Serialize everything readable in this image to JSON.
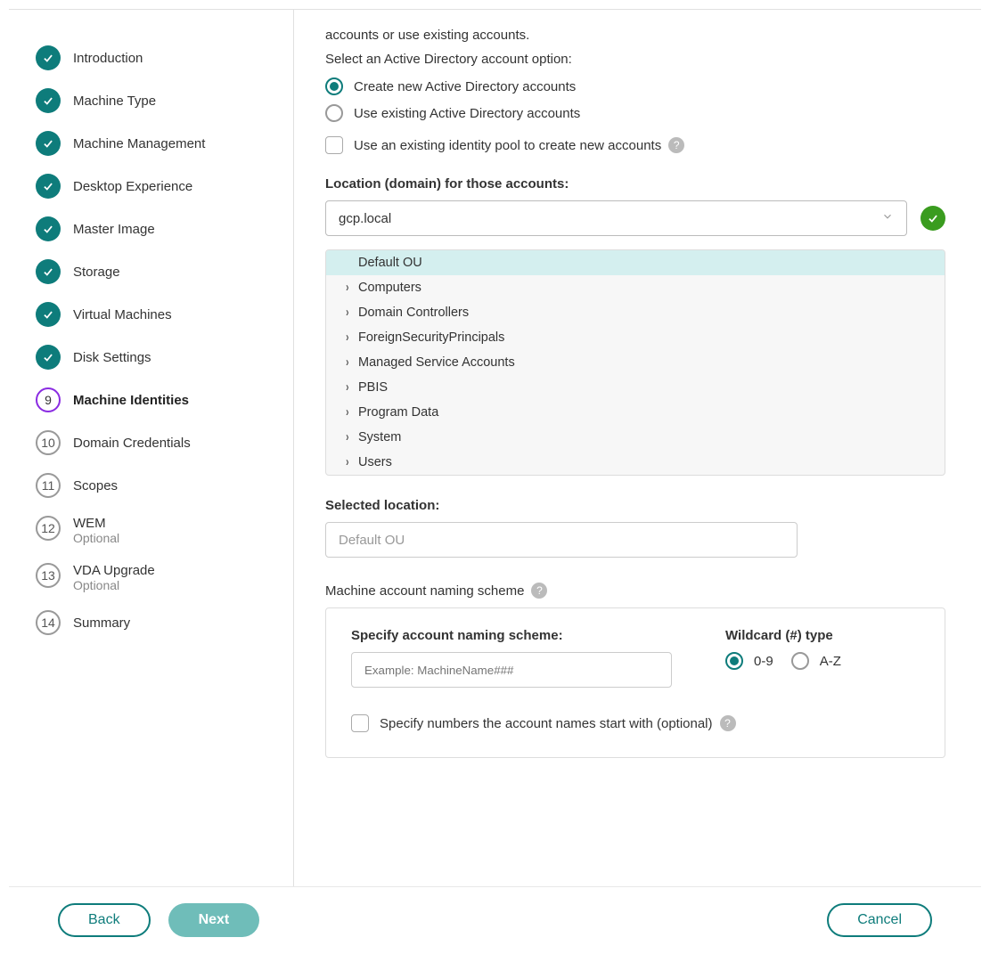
{
  "sidebar": {
    "steps": [
      {
        "label": "Introduction",
        "state": "complete"
      },
      {
        "label": "Machine Type",
        "state": "complete"
      },
      {
        "label": "Machine Management",
        "state": "complete"
      },
      {
        "label": "Desktop Experience",
        "state": "complete"
      },
      {
        "label": "Master Image",
        "state": "complete"
      },
      {
        "label": "Storage",
        "state": "complete"
      },
      {
        "label": "Virtual Machines",
        "state": "complete"
      },
      {
        "label": "Disk Settings",
        "state": "complete"
      },
      {
        "label": "Machine Identities",
        "state": "current",
        "num": "9"
      },
      {
        "label": "Domain Credentials",
        "state": "upcoming",
        "num": "10"
      },
      {
        "label": "Scopes",
        "state": "upcoming",
        "num": "11"
      },
      {
        "label": "WEM",
        "state": "upcoming",
        "num": "12",
        "sub": "Optional"
      },
      {
        "label": "VDA Upgrade",
        "state": "upcoming",
        "num": "13",
        "sub": "Optional"
      },
      {
        "label": "Summary",
        "state": "upcoming",
        "num": "14"
      }
    ]
  },
  "content": {
    "intro_trailing": "accounts or use existing accounts.",
    "prompt": "Select an Active Directory account option:",
    "radio_create": "Create new Active Directory accounts",
    "radio_existing": "Use existing Active Directory accounts",
    "chk_identity_pool": "Use an existing identity pool to create new accounts",
    "location_label": "Location (domain) for those accounts:",
    "domain_value": "gcp.local",
    "ou_items": [
      {
        "label": "Default OU",
        "expandable": false,
        "selected": true
      },
      {
        "label": "Computers",
        "expandable": true
      },
      {
        "label": "Domain Controllers",
        "expandable": true
      },
      {
        "label": "ForeignSecurityPrincipals",
        "expandable": true
      },
      {
        "label": "Managed Service Accounts",
        "expandable": true
      },
      {
        "label": "PBIS",
        "expandable": true
      },
      {
        "label": "Program Data",
        "expandable": true
      },
      {
        "label": "System",
        "expandable": true
      },
      {
        "label": "Users",
        "expandable": true
      }
    ],
    "selected_loc_label": "Selected location:",
    "selected_loc_value": "Default OU",
    "naming_header": "Machine account naming scheme",
    "naming_specify": "Specify account naming scheme:",
    "naming_placeholder": "Example: MachineName###",
    "wildcard_label": "Wildcard (#) type",
    "wildcard_numeric": "0-9",
    "wildcard_alpha": "A-Z",
    "spec_numbers": "Specify numbers the account names start with (optional)"
  },
  "footer": {
    "back": "Back",
    "next": "Next",
    "cancel": "Cancel"
  }
}
